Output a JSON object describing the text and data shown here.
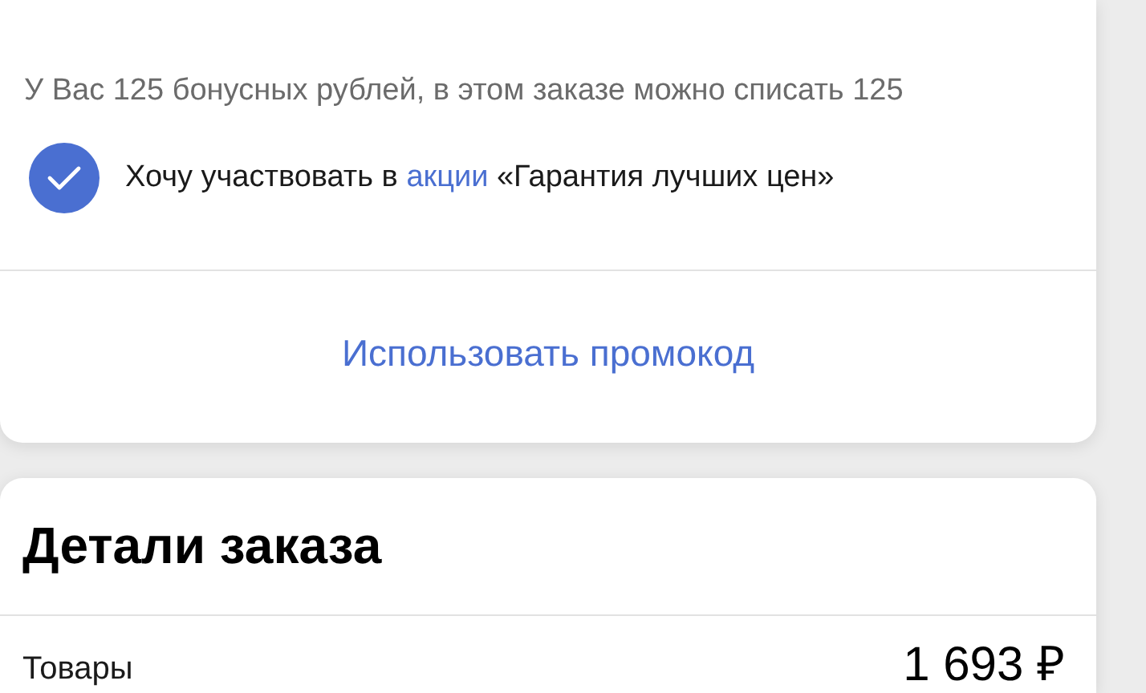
{
  "bonus_card": {
    "bonus_note": "У Вас 125 бонусных рублей, в этом заказе можно списать 125",
    "promo_checkbox": {
      "checked": true,
      "label_before": "Хочу участвовать в ",
      "link": "акции",
      "label_after": " «Гарантия лучших цен»"
    },
    "promo_code_link": "Использовать промокод"
  },
  "order_details": {
    "title": "Детали заказа",
    "rows": [
      {
        "label": "Товары",
        "value": "1 693 ₽"
      }
    ]
  }
}
